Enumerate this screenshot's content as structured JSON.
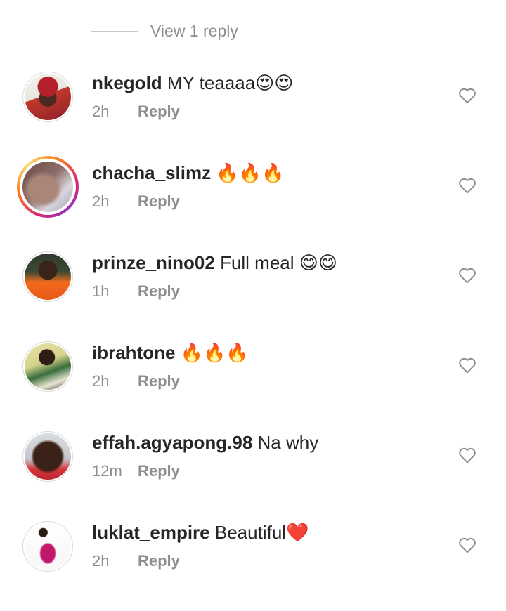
{
  "view_replies": {
    "label": "View 1 reply"
  },
  "comments": [
    {
      "username": "nkegold",
      "text": "MY teaaaa😍😍",
      "time": "2h",
      "reply_label": "Reply",
      "story_ring": false
    },
    {
      "username": "chacha_slimz",
      "text": "🔥🔥🔥",
      "time": "2h",
      "reply_label": "Reply",
      "story_ring": true
    },
    {
      "username": "prinze_nino02",
      "text": "Full meal 😋😋",
      "time": "1h",
      "reply_label": "Reply",
      "story_ring": false
    },
    {
      "username": "ibrahtone",
      "text": "🔥🔥🔥",
      "time": "2h",
      "reply_label": "Reply",
      "story_ring": false
    },
    {
      "username": "effah.agyapong.98",
      "text": "Na why",
      "time": "12m",
      "reply_label": "Reply",
      "story_ring": false
    },
    {
      "username": "luklat_empire",
      "text": "Beautiful❤️",
      "time": "2h",
      "reply_label": "Reply",
      "story_ring": false
    }
  ]
}
